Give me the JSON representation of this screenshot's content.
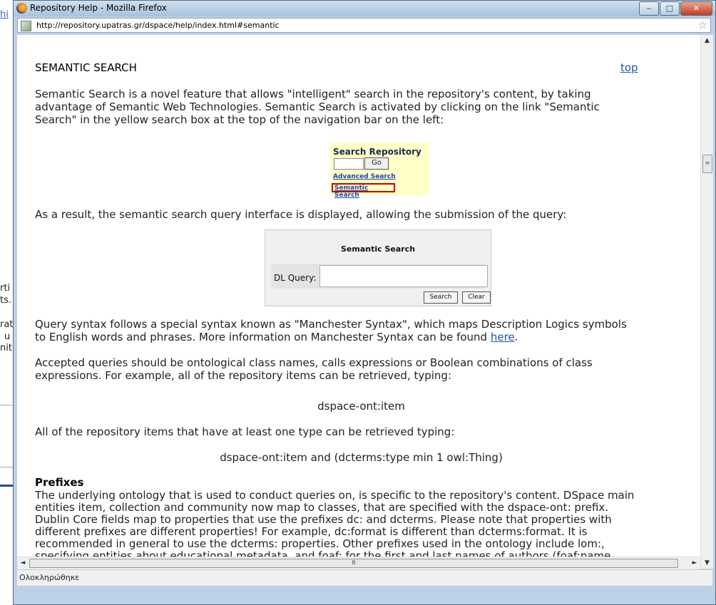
{
  "background": {
    "link_fragment": "hi",
    "text_fragments": [
      "rti",
      "ts.",
      "rat",
      "u",
      "nit"
    ]
  },
  "window": {
    "title": "Repository Help - Mozilla Firefox",
    "url": "http://repository.upatras.gr/dspace/help/index.html#semantic",
    "status": "Ολοκληρώθηκε"
  },
  "page": {
    "heading": "SEMANTIC SEARCH",
    "top_link": "top",
    "intro_lines": [
      "Semantic Search is a novel feature that allows \"intelligent\" search in the repository's content, by taking",
      "advantage of Semantic Web Technologies. Semantic Search is activated by clicking on the link \"Semantic",
      "Search\" in the yellow search box at the top of the navigation bar on the left:"
    ],
    "search_box": {
      "title": "Search Repository",
      "go_label": "Go",
      "advanced_label": "Advanced Search",
      "semantic_label": "Semantic Search"
    },
    "result_text": "As a result, the semantic search query interface is displayed, allowing the submission of the query:",
    "query_box": {
      "title": "Semantic Search",
      "field_label": "DL Query:",
      "search_label": "Search",
      "clear_label": "Clear"
    },
    "syntax_line1": "Query syntax follows a special syntax known as \"Manchester Syntax\", which maps Description Logics symbols",
    "syntax_line2_pre": "to English words and phrases. More information on Manchester Syntax can be found ",
    "syntax_link": "here",
    "syntax_line2_post": ".",
    "accepted_lines": [
      "Accepted queries should be ontological class names, calls expressions or Boolean combinations of class",
      "expressions. For example, all of the repository items can be retrieved, typing:"
    ],
    "example1": "dspace-ont:item",
    "typed_text": "All of the repository items that have at least one type can be retrieved typing:",
    "example2": "dspace-ont:item and (dcterms:type min 1 owl:Thing)",
    "prefixes_heading": "Prefixes",
    "prefixes_lines": [
      "The underlying ontology that is used to conduct queries on, is specific to the repository's content. DSpace main",
      "entities item, collection and community now map to classes, that are specified with the dspace-ont: prefix.",
      "Dublin Core fields map to properties that use the prefixes dc: and dcterms. Please note that properties with",
      "different prefixes are different properties! For example, dc:format is different than dcterms:format. It is",
      "recommended in general to use the dcterms: properties. Other prefixes used in the ontology include lom:,",
      "specifying entities about educational metadata, and foaf: for the first and last names of authors (foaf:name,"
    ]
  }
}
